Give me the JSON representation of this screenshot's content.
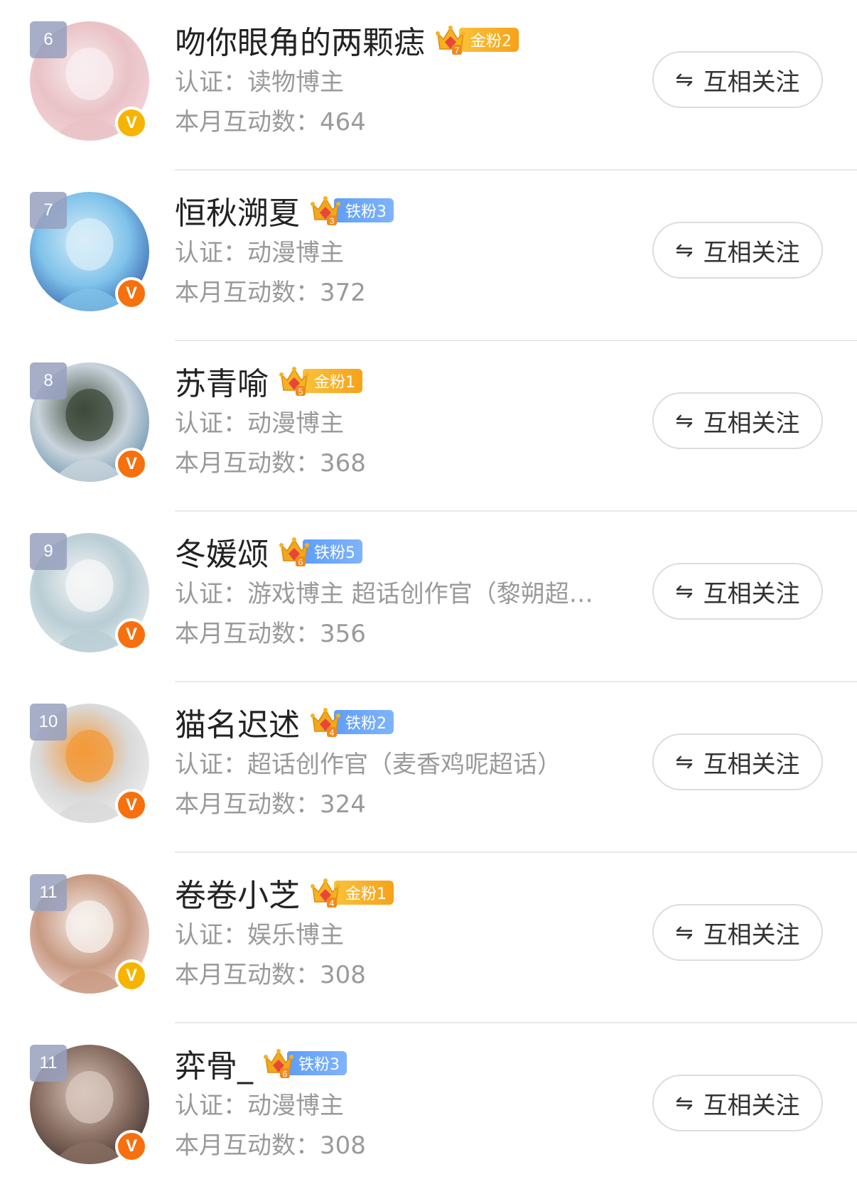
{
  "labels": {
    "cert_prefix": "认证：",
    "interact_prefix": "本月互动数：",
    "follow_btn": "互相关注",
    "swap_glyph": "⇋",
    "verified_glyph": "V"
  },
  "colors": {
    "gold_badge": "#f7a21a",
    "iron_badge": "#5f9ef8",
    "verified_gold": "#f6b400",
    "verified_orange": "#f6700e"
  },
  "rows": [
    {
      "rank": "6",
      "name": "吻你眼角的两颗痣",
      "badge_type": "gold",
      "crown_level": "7",
      "badge_text": "金粉2",
      "cert": "读物博主",
      "count": "464",
      "verified": "gold",
      "avatar_hue": [
        "#f5d8dc",
        "#e9c2c6",
        "#f9eef0"
      ]
    },
    {
      "rank": "7",
      "name": "恒秋溯夏",
      "badge_type": "iron",
      "crown_level": "3",
      "badge_text": "铁粉3",
      "cert": "动漫博主",
      "count": "372",
      "verified": "orange",
      "avatar_hue": [
        "#2f5aa8",
        "#7fc2ea",
        "#d8eef8"
      ]
    },
    {
      "rank": "8",
      "name": "苏青喻",
      "badge_type": "gold",
      "crown_level": "5",
      "badge_text": "金粉1",
      "cert": "动漫博主",
      "count": "368",
      "verified": "orange",
      "avatar_hue": [
        "#5e8aa8",
        "#c9d4dc",
        "#3d4a3a"
      ]
    },
    {
      "rank": "9",
      "name": "冬媛颂",
      "badge_type": "iron",
      "crown_level": "6",
      "badge_text": "铁粉5",
      "cert": "游戏博主 超话创作官（黎朔超…",
      "count": "356",
      "verified": "orange",
      "avatar_hue": [
        "#e8eef0",
        "#b9cdd4",
        "#f7f7f7"
      ]
    },
    {
      "rank": "10",
      "name": "猫名迟述",
      "badge_type": "iron",
      "crown_level": "4",
      "badge_text": "铁粉2",
      "cert": "超话创作官（麦香鸡呢超话）",
      "count": "324",
      "verified": "orange",
      "avatar_hue": [
        "#f1f1f1",
        "#d9d9d9",
        "#f39a3a"
      ]
    },
    {
      "rank": "11",
      "name": "卷卷小芝",
      "badge_type": "gold",
      "crown_level": "4",
      "badge_text": "金粉1",
      "cert": "娱乐博主",
      "count": "308",
      "verified": "gold",
      "avatar_hue": [
        "#f3dfe0",
        "#c89a82",
        "#f7f1ee"
      ]
    },
    {
      "rank": "11",
      "name": "弈骨_",
      "badge_type": "iron",
      "crown_level": "6",
      "badge_text": "铁粉3",
      "cert": "动漫博主",
      "count": "308",
      "verified": "orange",
      "avatar_hue": [
        "#3b2f2c",
        "#8a6f63",
        "#d9c7bd"
      ]
    }
  ]
}
